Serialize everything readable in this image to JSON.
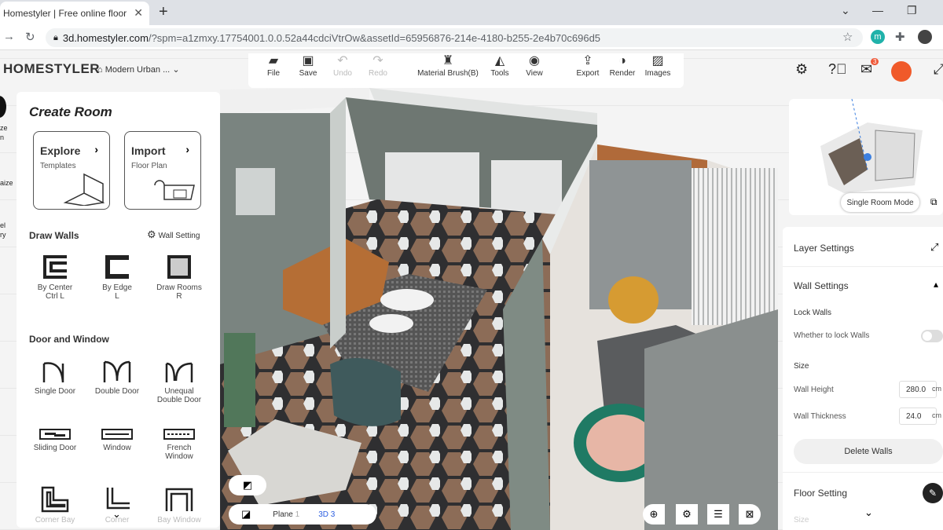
{
  "browser": {
    "tab_title": "Homestyler | Free online floor pla",
    "url_host": "3d.homestyler.com",
    "url_rest": "/?spm=a1zmxy.17754001.0.0.52a44cdciVtrOw&assetId=65956876-214e-4180-b255-2e4b70c696d5",
    "new_tab": "+",
    "ext_badge": "m",
    "mail_badge": "3"
  },
  "app": {
    "brand": "HOMESTYLER",
    "project": "Modern Urban ..."
  },
  "toolbar": {
    "items": [
      {
        "label": "File",
        "icon": "folder-icon",
        "glyph": "▰"
      },
      {
        "label": "Save",
        "icon": "save-icon",
        "glyph": "▣"
      },
      {
        "label": "Undo",
        "icon": "undo-icon",
        "glyph": "↶"
      },
      {
        "label": "Redo",
        "icon": "redo-icon",
        "glyph": "↷"
      },
      {
        "label": "Material Brush(B)",
        "icon": "brush-icon",
        "glyph": "♜"
      },
      {
        "label": "Tools",
        "icon": "tools-icon",
        "glyph": "◭"
      },
      {
        "label": "View",
        "icon": "eye-icon",
        "glyph": "◉"
      },
      {
        "label": "Export",
        "icon": "export-icon",
        "glyph": "⇪"
      },
      {
        "label": "Render",
        "icon": "render-icon",
        "glyph": "◑"
      },
      {
        "label": "Images",
        "icon": "images-icon",
        "glyph": "▨"
      }
    ]
  },
  "leftedge": {
    "a": "ze",
    "b": "n",
    "c": "aize",
    "d": "el",
    "e": "ry"
  },
  "panel": {
    "title": "Create Room",
    "explore": {
      "title": "Explore",
      "sub": "Templates"
    },
    "import": {
      "title": "Import",
      "sub": "Floor Plan"
    },
    "draw_walls": "Draw Walls",
    "wall_setting": "Wall Setting",
    "walls": [
      {
        "l1": "By Center",
        "l2": "Ctrl L"
      },
      {
        "l1": "By Edge",
        "l2": "L"
      },
      {
        "l1": "Draw Rooms",
        "l2": "R"
      }
    ],
    "door_window": "Door and Window",
    "doors": [
      {
        "l1": "Single Door",
        "l2": ""
      },
      {
        "l1": "Double Door",
        "l2": ""
      },
      {
        "l1": "Unequal",
        "l2": "Double Door"
      },
      {
        "l1": "Sliding Door",
        "l2": ""
      },
      {
        "l1": "Window",
        "l2": ""
      },
      {
        "l1": "French",
        "l2": "Window"
      },
      {
        "l1": "Corner Bay",
        "l2": ""
      },
      {
        "l1": "Corner",
        "l2": ""
      },
      {
        "l1": "Bay Window",
        "l2": ""
      }
    ]
  },
  "minimap": {
    "mode": "Single Room Mode"
  },
  "rpanel": {
    "layer": "Layer Settings",
    "wall_settings": "Wall Settings",
    "lock_walls": "Lock Walls",
    "lock_q": "Whether to lock Walls",
    "size": "Size",
    "height_l": "Wall Height",
    "height_v": "280.0",
    "thick_l": "Wall Thickness",
    "thick_v": "24.0",
    "unit": "cm",
    "delete": "Delete Walls",
    "floor": "Floor Setting",
    "size2": "Size"
  },
  "viewbar": {
    "plane": "Plane",
    "plane_n": "1",
    "d3": "3D",
    "d3_n": "3"
  }
}
